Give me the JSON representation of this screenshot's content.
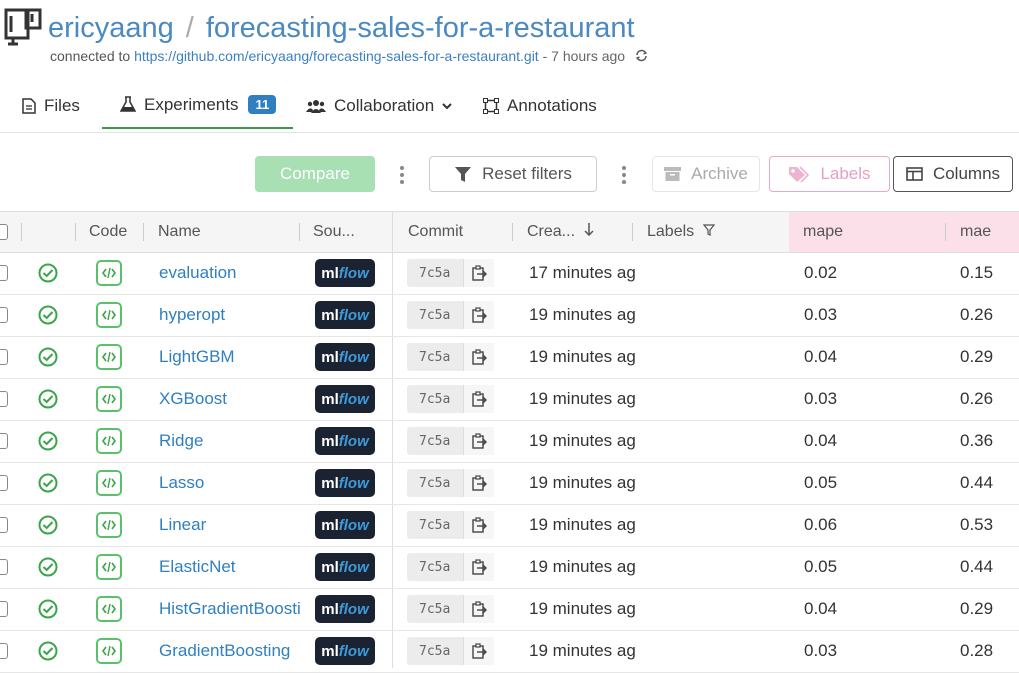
{
  "header": {
    "owner": "ericyaang",
    "separator": "/",
    "repo": "forecasting-sales-for-a-restaurant",
    "connected_prefix": "connected to",
    "connected_url": "https://github.com/ericyaang/forecasting-sales-for-a-restaurant.git",
    "connected_time": "- 7 hours ago"
  },
  "tabs": {
    "files": "Files",
    "experiments": "Experiments",
    "experiments_count": "11",
    "collaboration": "Collaboration",
    "annotations": "Annotations"
  },
  "toolbar": {
    "compare": "Compare",
    "reset_filters": "Reset filters",
    "archive": "Archive",
    "labels": "Labels",
    "columns": "Columns"
  },
  "table": {
    "headers": {
      "code": "Code",
      "name": "Name",
      "source": "Sou...",
      "commit": "Commit",
      "created": "Crea...",
      "labels": "Labels",
      "mape": "mape",
      "mae": "mae"
    },
    "rows": [
      {
        "name": "evaluation",
        "source": "mlflow",
        "commit": "7c5a",
        "created": "17 minutes ag",
        "mape": "0.02",
        "mae": "0.15"
      },
      {
        "name": "hyperopt",
        "source": "mlflow",
        "commit": "7c5a",
        "created": "19 minutes ag",
        "mape": "0.03",
        "mae": "0.26"
      },
      {
        "name": "LightGBM",
        "source": "mlflow",
        "commit": "7c5a",
        "created": "19 minutes ag",
        "mape": "0.04",
        "mae": "0.29"
      },
      {
        "name": "XGBoost",
        "source": "mlflow",
        "commit": "7c5a",
        "created": "19 minutes ag",
        "mape": "0.03",
        "mae": "0.26"
      },
      {
        "name": "Ridge",
        "source": "mlflow",
        "commit": "7c5a",
        "created": "19 minutes ag",
        "mape": "0.04",
        "mae": "0.36"
      },
      {
        "name": "Lasso",
        "source": "mlflow",
        "commit": "7c5a",
        "created": "19 minutes ag",
        "mape": "0.05",
        "mae": "0.44"
      },
      {
        "name": "Linear",
        "source": "mlflow",
        "commit": "7c5a",
        "created": "19 minutes ag",
        "mape": "0.06",
        "mae": "0.53"
      },
      {
        "name": "ElasticNet",
        "source": "mlflow",
        "commit": "7c5a",
        "created": "19 minutes ag",
        "mape": "0.05",
        "mae": "0.44"
      },
      {
        "name": "HistGradientBoosti",
        "source": "mlflow",
        "commit": "7c5a",
        "created": "19 minutes ag",
        "mape": "0.04",
        "mae": "0.29"
      },
      {
        "name": "GradientBoosting",
        "source": "mlflow",
        "commit": "7c5a",
        "created": "19 minutes ag",
        "mape": "0.03",
        "mae": "0.28"
      }
    ]
  },
  "colors": {
    "link": "#2f7fc1",
    "success": "#3aa54a",
    "compare_bg": "#a8dfb3",
    "labels_accent": "#e6a0c3"
  }
}
